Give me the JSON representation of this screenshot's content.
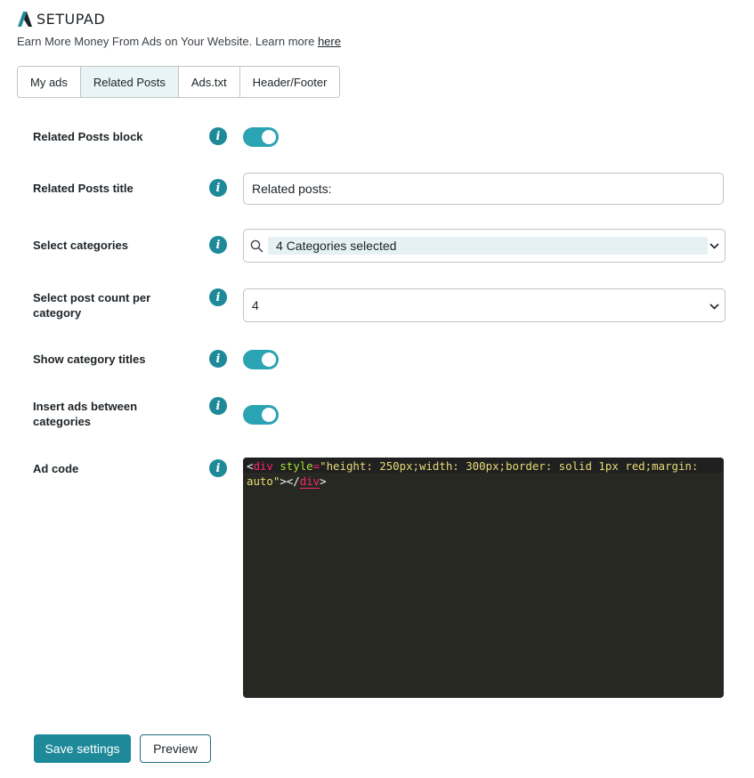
{
  "brand": {
    "name": "SETUPAD",
    "accent": "#1e8a99"
  },
  "tagline": {
    "text": "Earn More Money From Ads on Your Website. Learn more ",
    "link": "here"
  },
  "tabs": [
    {
      "label": "My ads",
      "active": false
    },
    {
      "label": "Related Posts",
      "active": true
    },
    {
      "label": "Ads.txt",
      "active": false
    },
    {
      "label": "Header/Footer",
      "active": false
    }
  ],
  "settings": {
    "related_block": {
      "label": "Related Posts block",
      "enabled": true
    },
    "related_title": {
      "label": "Related Posts title",
      "value": "Related posts:"
    },
    "categories": {
      "label": "Select categories",
      "selected_text": "4 Categories selected"
    },
    "post_count": {
      "label": "Select post count per category",
      "value": "4"
    },
    "category_titles": {
      "label": "Show category titles",
      "enabled": true
    },
    "ads_between": {
      "label": "Insert ads between categories",
      "enabled": true
    },
    "ad_code": {
      "label": "Ad code",
      "code": "<div style=\"height: 250px;width: 300px;border: solid 1px red;margin: auto\"></div>",
      "tokens": {
        "lt": "<",
        "tag": "div",
        "attr": "style",
        "eq": "=",
        "str": "\"height: 250px;width: 300px;border: solid 1px red;margin: auto\"",
        "close_open": "></",
        "tag_close": "div",
        "gt": ">"
      }
    }
  },
  "info_icon": "i",
  "buttons": {
    "save": "Save settings",
    "preview": "Preview"
  }
}
